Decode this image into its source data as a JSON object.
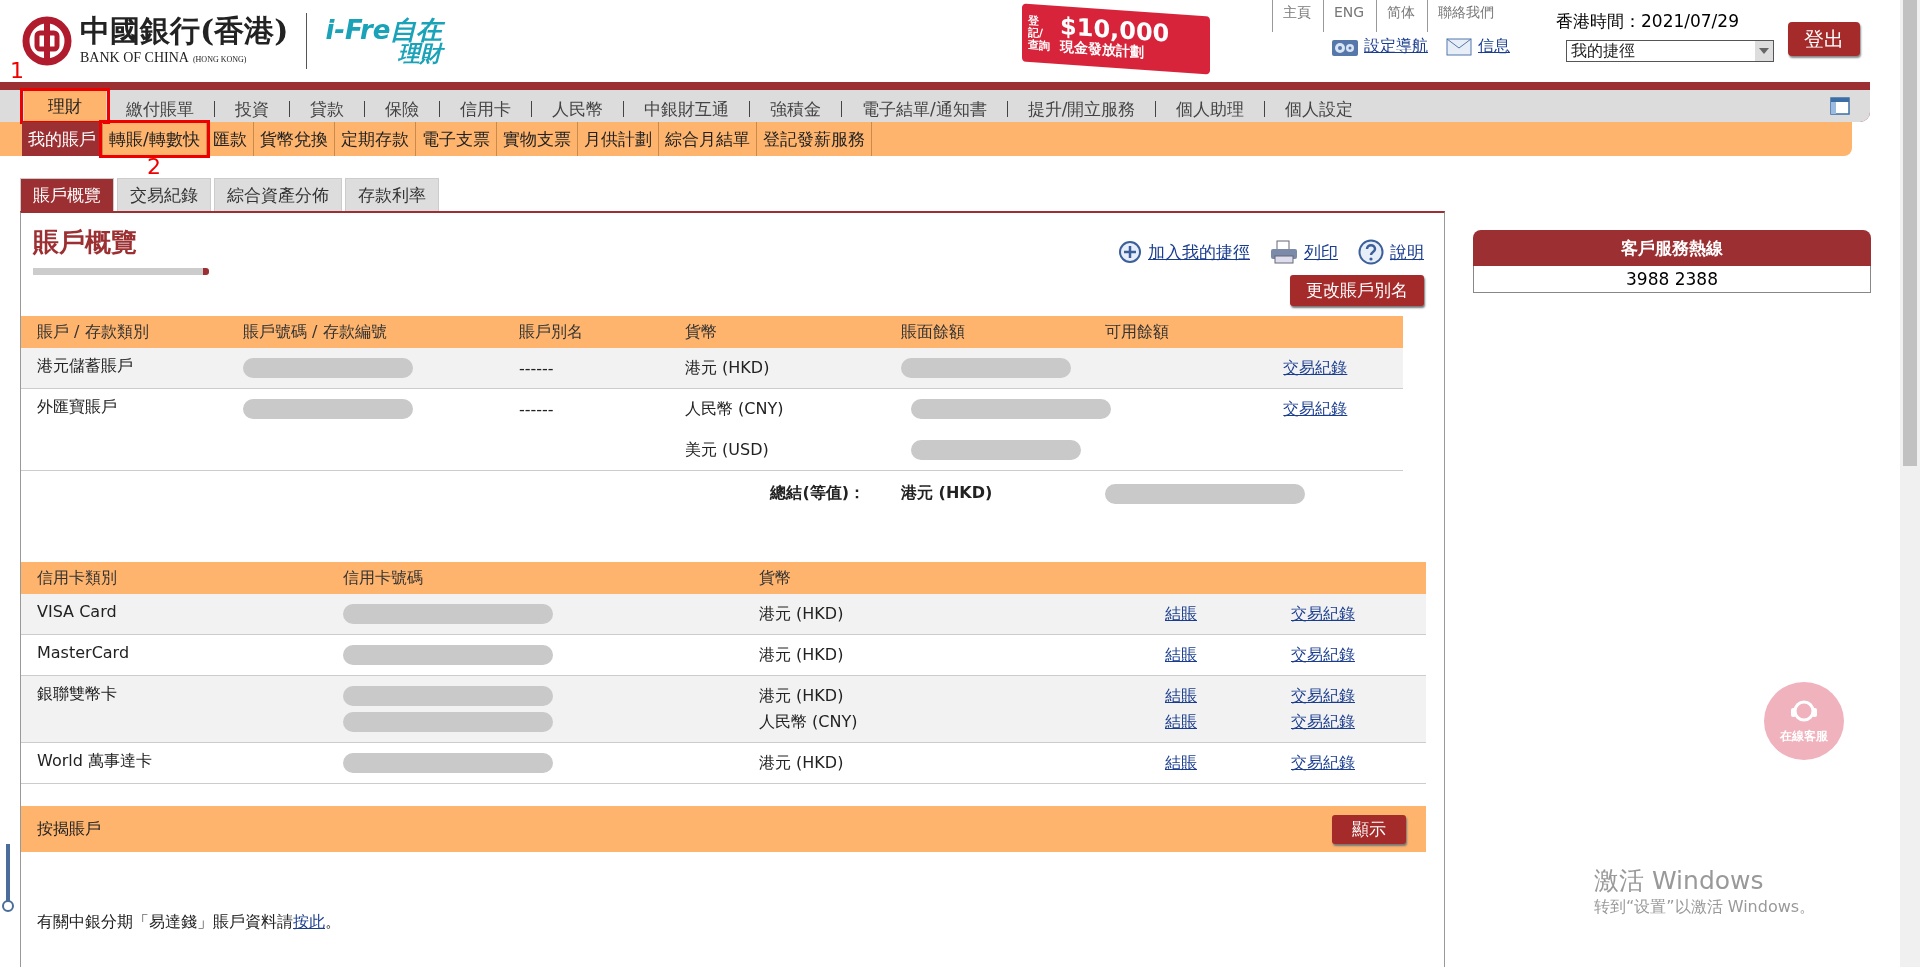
{
  "header": {
    "logo_cn": "中國銀行(香港)",
    "logo_en": "BANK OF CHINA",
    "logo_hk": "(HONG KONG)",
    "brand_top": "i-Fre自在",
    "brand_bottom": "理財",
    "promo": {
      "tag": "登記/查詢",
      "amount": "$10,000",
      "caption": "現金發放計劃"
    },
    "top_links": [
      "主頁",
      "ENG",
      "简体",
      "聯絡我們"
    ],
    "time": "香港時間：2021/07/29",
    "logout": "登出",
    "tool_links": [
      {
        "kind": "gear",
        "label": "設定導航"
      },
      {
        "kind": "mail",
        "label": "信息"
      }
    ],
    "shortcut": {
      "value": "我的捷徑"
    }
  },
  "main_nav": [
    {
      "label": "理財",
      "selected": true,
      "annotation": "1"
    },
    {
      "label": "繳付賬單",
      "selected": false
    },
    {
      "label": "投資",
      "selected": false
    },
    {
      "label": "貸款",
      "selected": false
    },
    {
      "label": "保險",
      "selected": false
    },
    {
      "label": "信用卡",
      "selected": false
    },
    {
      "label": "人民幣",
      "selected": false
    },
    {
      "label": "中銀財互通",
      "selected": false
    },
    {
      "label": "強積金",
      "selected": false
    },
    {
      "label": "電子結單/通知書",
      "selected": false
    },
    {
      "label": "提升/開立服務",
      "selected": false
    },
    {
      "label": "個人助理",
      "selected": false
    },
    {
      "label": "個人設定",
      "selected": false
    }
  ],
  "sub_nav": [
    {
      "label": "我的賬戶",
      "selected": true
    },
    {
      "label": "轉賬/轉數快",
      "selected": false,
      "annotation": "2"
    },
    {
      "label": "匯款",
      "selected": false
    },
    {
      "label": "貨幣兌換",
      "selected": false
    },
    {
      "label": "定期存款",
      "selected": false
    },
    {
      "label": "電子支票",
      "selected": false
    },
    {
      "label": "實物支票",
      "selected": false
    },
    {
      "label": "月供計劃",
      "selected": false
    },
    {
      "label": "綜合月結單",
      "selected": false
    },
    {
      "label": "登記發薪服務",
      "selected": false
    }
  ],
  "tabs": [
    {
      "label": "賬戶概覽",
      "selected": true
    },
    {
      "label": "交易紀錄",
      "selected": false
    },
    {
      "label": "綜合資產分佈",
      "selected": false
    },
    {
      "label": "存款利率",
      "selected": false
    }
  ],
  "page_title": "賬戶概覽",
  "actions": [
    {
      "kind": "plus",
      "label": "加入我的捷徑"
    },
    {
      "kind": "print",
      "label": "列印"
    },
    {
      "kind": "help",
      "label": "說明"
    }
  ],
  "rename_button": "更改賬戶別名",
  "accounts": {
    "columns": [
      "賬戶 / 存款類別",
      "賬戶號碼 / 存款編號",
      "賬戶別名",
      "貨幣",
      "賬面餘額",
      "可用餘額"
    ],
    "rows": [
      {
        "type": "港元儲蓄賬戶",
        "alias": "------",
        "lines": [
          {
            "currency": "港元 (HKD)",
            "link": "交易紀錄"
          }
        ]
      },
      {
        "type": "外匯寶賬戶",
        "alias": "------",
        "lines": [
          {
            "currency": "人民幣 (CNY)",
            "link": "交易紀錄"
          },
          {
            "currency": "美元 (USD)"
          }
        ]
      }
    ],
    "total": {
      "label": "總結(等值)：",
      "currency": "港元 **(HKD)**"
    }
  },
  "cards": {
    "columns": [
      "信用卡類別",
      "信用卡號碼",
      "貨幣"
    ],
    "rows": [
      {
        "type": "VISA Card",
        "lines": [
          {
            "currency": "港元 (HKD)",
            "pay": "結賬",
            "history": "交易紀錄"
          }
        ]
      },
      {
        "type": "MasterCard",
        "lines": [
          {
            "currency": "港元 (HKD)",
            "pay": "結賬",
            "history": "交易紀錄"
          }
        ]
      },
      {
        "type": "銀聯雙幣卡",
        "lines": [
          {
            "currency": "港元 (HKD)",
            "pay": "結賬",
            "history": "交易紀錄"
          },
          {
            "currency": "人民幣 (CNY)",
            "pay": "結賬",
            "history": "交易紀錄"
          }
        ]
      },
      {
        "type": "World 萬事達卡",
        "lines": [
          {
            "currency": "港元 (HKD)",
            "pay": "結賬",
            "history": "交易紀錄"
          }
        ]
      }
    ]
  },
  "mortgage": {
    "label": "按揭賬戶",
    "button": "顯示"
  },
  "note": {
    "text": "有關中銀分期「易達錢」賬戶資料請",
    "link": "按此",
    "end": "。"
  },
  "hotline": {
    "title": "客戶服務熱線",
    "number": "3988 2388"
  },
  "chat": "在線客服",
  "os_notice": {
    "title": "激活 Windows",
    "text": "转到“设置”以激活 Windows。"
  }
}
